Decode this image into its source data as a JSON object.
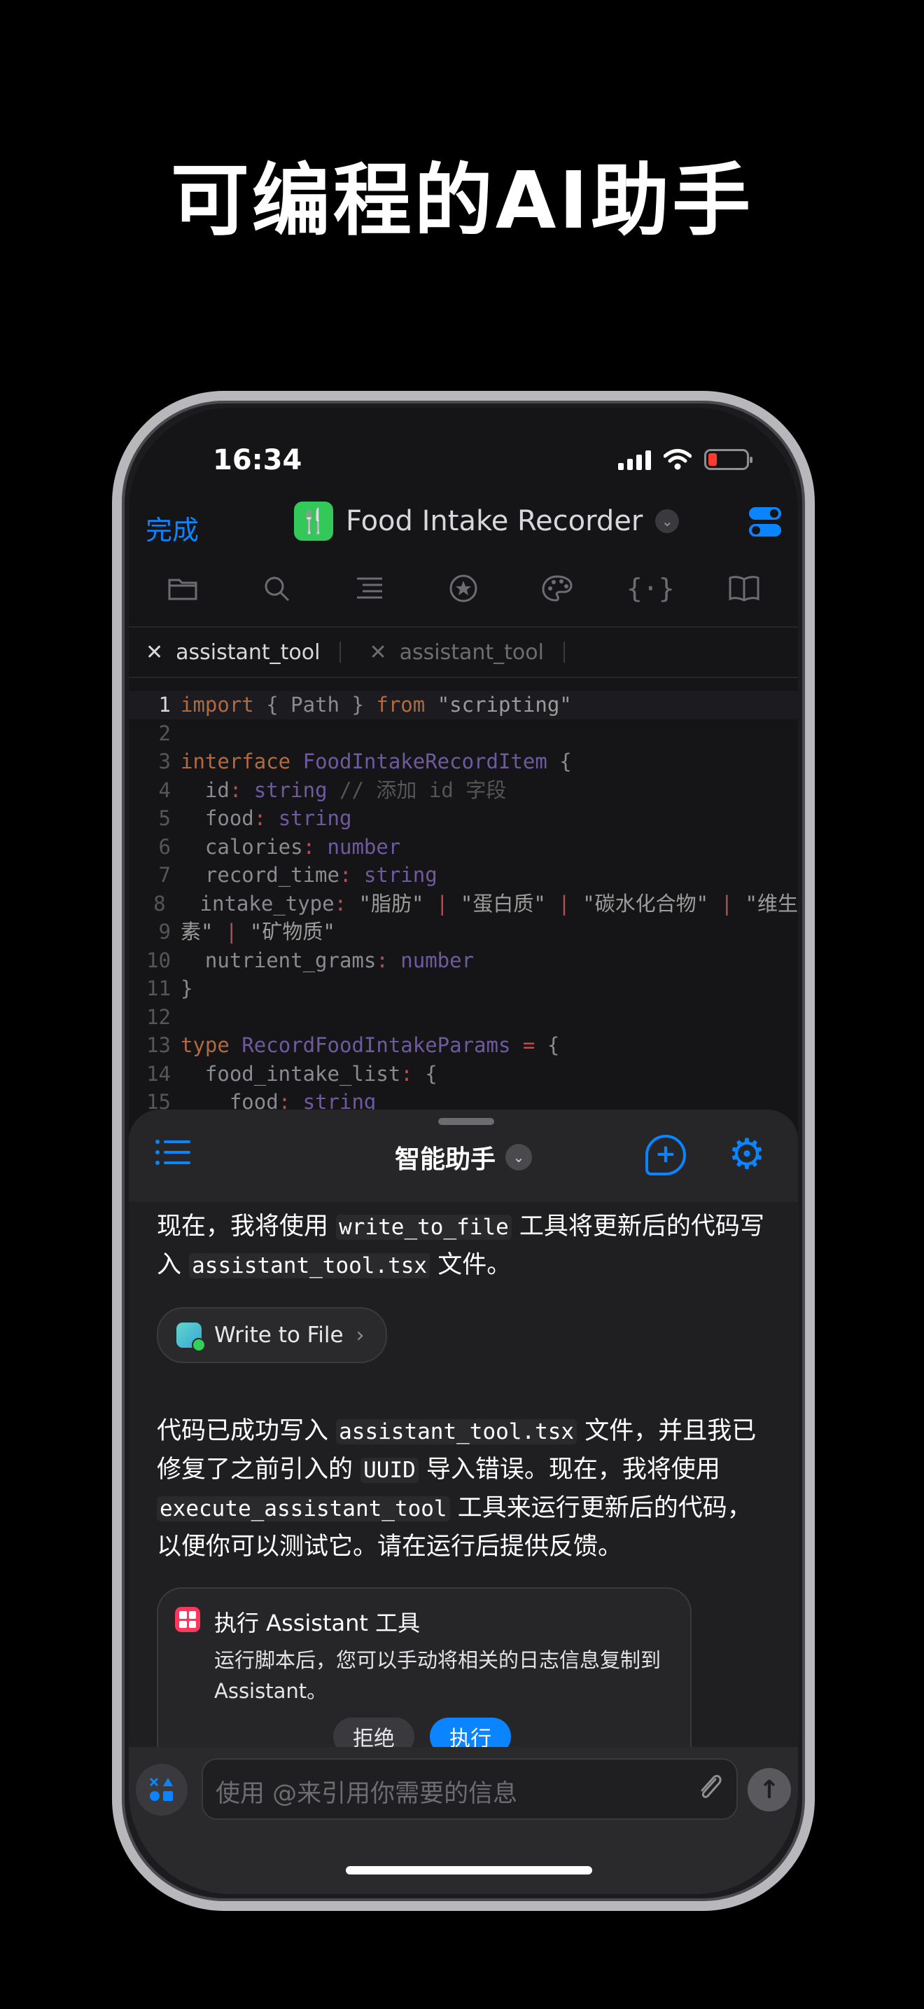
{
  "headline": "可编程的AI助手",
  "status": {
    "time": "16:34"
  },
  "editor": {
    "done_label": "完成",
    "project_title": "Food Intake Recorder",
    "tabs": [
      {
        "label": "assistant_tool"
      },
      {
        "label": "assistant_tool"
      }
    ],
    "toolbar_icons": [
      "folder-icon",
      "search-icon",
      "outline-icon",
      "star-icon",
      "palette-icon",
      "braces-icon",
      "book-icon"
    ]
  },
  "code_lines": [
    {
      "n": "1"
    },
    {
      "n": "2"
    },
    {
      "n": "3"
    },
    {
      "n": "4"
    },
    {
      "n": "5"
    },
    {
      "n": "6"
    },
    {
      "n": "7"
    },
    {
      "n": "8"
    },
    {
      "n": "9"
    },
    {
      "n": "10"
    },
    {
      "n": "11"
    },
    {
      "n": "12"
    },
    {
      "n": "13"
    },
    {
      "n": "14"
    },
    {
      "n": "15"
    }
  ],
  "assistant": {
    "title": "智能助手",
    "msg1": {
      "a": "现在，我将使用 ",
      "code1": "write_to_file",
      "b": " 工具将更新后的代码写入 ",
      "code2": "assistant_tool.tsx",
      "c": " 文件。"
    },
    "tool_chip": "Write to File",
    "msg2": {
      "a": "代码已成功写入 ",
      "code1": "assistant_tool.tsx",
      "b": " 文件，并且我已修复了之前引入的 ",
      "code2": "UUID",
      "c": " 导入错误。现在，我将使用 ",
      "code3": "execute_assistant_tool",
      "d": " 工具来运行更新后的代码，以便你可以测试它。请在运行后提供反馈。"
    },
    "card": {
      "title": "执行 Assistant 工具",
      "desc": "运行脚本后，您可以手动将相关的日志信息复制到 Assistant。",
      "reject": "拒绝",
      "execute": "执行"
    },
    "input_placeholder": "使用 @来引用你需要的信息"
  },
  "colors": {
    "accent": "#0a84ff",
    "app_icon": "#34c759",
    "card_icon": "#ff375f"
  }
}
